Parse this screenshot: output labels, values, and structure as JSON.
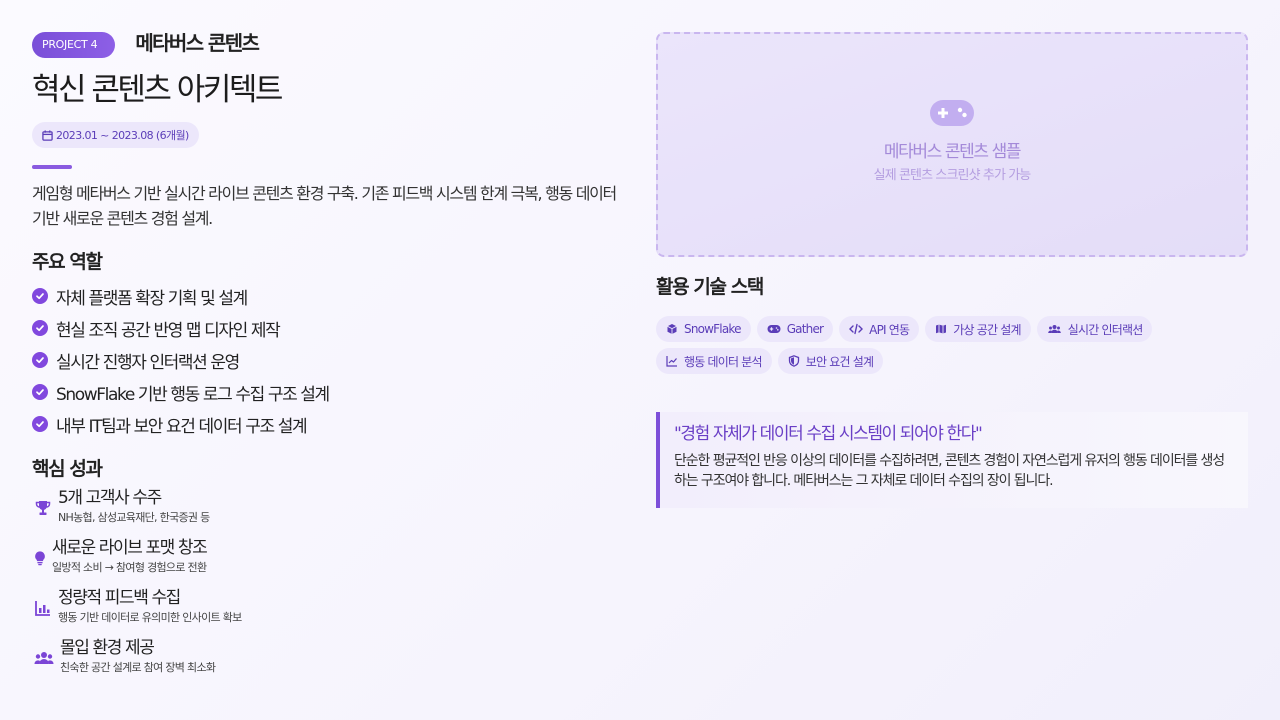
{
  "project": {
    "badge": "PROJECT 4",
    "name": "메타버스 콘텐츠",
    "title": "혁신 콘텐츠 아키텍트",
    "period": "2023.01 ~ 2023.08 (6개월)",
    "description": "게임형 메타버스 기반 실시간 라이브 콘텐츠 환경 구축. 기존 피드백 시스템 한계 극복, 행동 데이터 기반 새로운 콘텐츠 경험 설계."
  },
  "roles": {
    "title": "주요 역할",
    "items": [
      "자체 플랫폼 확장 기획 및 설계",
      "현실 조직 공간 반영 맵 디자인 제작",
      "실시간 진행자 인터랙션 운영",
      "SnowFlake 기반 행동 로그 수집 구조 설계",
      "내부 IT팀과 보안 요건 데이터 구조 설계"
    ]
  },
  "achievements": {
    "title": "핵심 성과",
    "items": [
      {
        "title": "5개 고객사 수주",
        "sub": "NH농협, 삼성교육재단, 한국증권 등",
        "icon": "trophy-icon"
      },
      {
        "title": "새로운 라이브 포맷 창조",
        "sub": "일방적 소비 → 참여형 경험으로 전환",
        "icon": "lightbulb-icon"
      },
      {
        "title": "정량적 피드백 수집",
        "sub": "행동 기반 데이터로 유의미한 인사이트 확보",
        "icon": "bar-chart-icon"
      },
      {
        "title": "몰입 환경 제공",
        "sub": "친숙한 공간 설계로 참여 장벽 최소화",
        "icon": "users-icon"
      }
    ]
  },
  "sample": {
    "title": "메타버스 콘텐츠 샘플",
    "subtitle": "실제 콘텐츠 스크린샷 추가 가능",
    "icon": "gamepad-icon"
  },
  "stack": {
    "title": "활용 기술 스택",
    "chips": [
      {
        "label": "SnowFlake",
        "icon": "cube-icon"
      },
      {
        "label": "Gather",
        "icon": "gamepad-icon"
      },
      {
        "label": "API 연동",
        "icon": "code-icon"
      },
      {
        "label": "가상 공간 설계",
        "icon": "map-icon"
      },
      {
        "label": "실시간 인터랙션",
        "icon": "users-icon"
      },
      {
        "label": "행동 데이터 분석",
        "icon": "line-chart-icon"
      },
      {
        "label": "보안 요건 설계",
        "icon": "shield-icon"
      }
    ]
  },
  "quote": {
    "title": "\"경험 자체가 데이터 수집 시스템이 되어야 한다\"",
    "body": "단순한 평균적인 반응 이상의 데이터를 수집하려면, 콘텐츠 경험이 자연스럽게 유저의 행동 데이터를 생성하는 구조여야 합니다. 메타버스는 그 자체로 데이터 수집의 장이 됩니다."
  },
  "colors": {
    "accent": "#8148de",
    "chip_bg": "#ece7fb",
    "chip_text": "#5b3db8"
  }
}
